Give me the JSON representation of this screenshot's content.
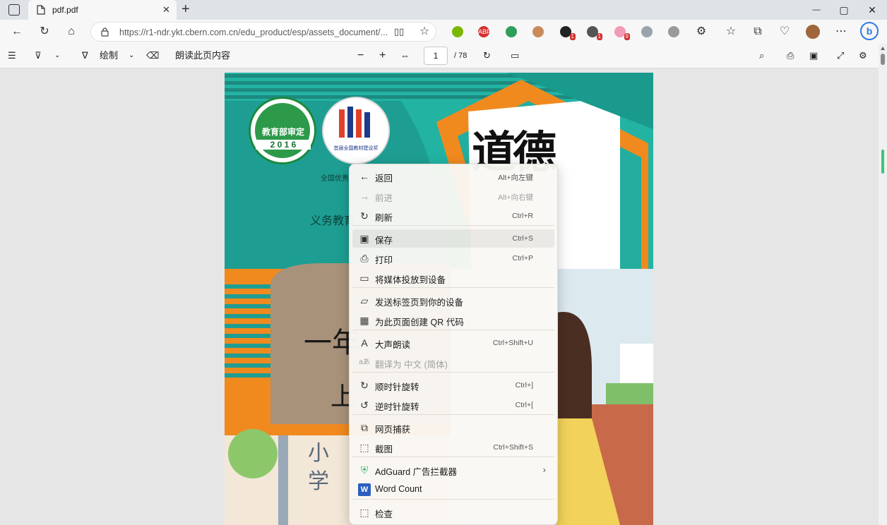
{
  "tab": {
    "title": "pdf.pdf",
    "new_tab": "+"
  },
  "window": {
    "minimize": "—",
    "restore": "▢",
    "close": "✕"
  },
  "address": {
    "url": "https://r1-ndr.ykt.cbern.com.cn/edu_product/esp/assets_document/..."
  },
  "extensions": [
    {
      "name": "extension-green-icon",
      "color": "#7ab800"
    },
    {
      "name": "adblock-icon",
      "color": "#d32f2f",
      "text": "ABP"
    },
    {
      "name": "shield-check-icon",
      "color": "#2e9e5a"
    },
    {
      "name": "face-icon",
      "color": "#c98a5a"
    },
    {
      "name": "ext-black-icon",
      "color": "#222222",
      "badge": "1"
    },
    {
      "name": "ext-chat-icon",
      "color": "#555555",
      "badge": "1"
    },
    {
      "name": "ext-pink-icon",
      "color": "#f29bb5",
      "badge": "9"
    },
    {
      "name": "ext-gray-icon",
      "color": "#9aa3ad"
    },
    {
      "name": "ext-circle-icon",
      "color": "#9a9a9a"
    }
  ],
  "pdf_toolbar": {
    "draw_label": "绘制",
    "read_label": "朗读此页内容",
    "page_current": "1",
    "page_total": "/ 78"
  },
  "cover": {
    "seal_text": "教育部审定",
    "seal_year": "2 0 1 6",
    "award_text": "首届全国教材建设奖",
    "award_caption": "全国优秀",
    "series": "义务教育",
    "title_top": "道德",
    "grade": "一年",
    "volume": "上",
    "bottom_chars": "小学"
  },
  "context_menu": {
    "items": [
      {
        "icon": "back-arrow-icon",
        "glyph": "←",
        "label": "返回",
        "shortcut": "Alt+向左键",
        "disabled": false
      },
      {
        "icon": "forward-arrow-icon",
        "glyph": "→",
        "label": "前进",
        "shortcut": "Alt+向右键",
        "disabled": true
      },
      {
        "icon": "refresh-icon",
        "glyph": "↻",
        "label": "刷新",
        "shortcut": "Ctrl+R",
        "disabled": false
      },
      {
        "icon": "save-icon",
        "glyph": "▣",
        "label": "保存",
        "shortcut": "Ctrl+S",
        "disabled": false
      },
      {
        "icon": "print-icon",
        "glyph": "⎙",
        "label": "打印",
        "shortcut": "Ctrl+P",
        "disabled": false
      },
      {
        "icon": "cast-icon",
        "glyph": "▭",
        "label": "将媒体投放到设备",
        "shortcut": "",
        "disabled": false
      },
      {
        "icon": "send-to-device-icon",
        "glyph": "▱",
        "label": "发送标签页到你的设备",
        "shortcut": "",
        "disabled": false
      },
      {
        "icon": "qr-code-icon",
        "glyph": "▦",
        "label": "为此页面创建 QR 代码",
        "shortcut": "",
        "disabled": false
      },
      {
        "icon": "read-aloud-icon",
        "glyph": "A",
        "label": "大声朗读",
        "shortcut": "Ctrl+Shift+U",
        "disabled": false
      },
      {
        "icon": "translate-icon",
        "glyph": "aあ",
        "label": "翻译为 中文 (简体)",
        "shortcut": "",
        "disabled": true
      },
      {
        "icon": "rotate-clockwise-icon",
        "glyph": "↻",
        "label": "顺时针旋转",
        "shortcut": "Ctrl+]",
        "disabled": false
      },
      {
        "icon": "rotate-counterclockwise-icon",
        "glyph": "↺",
        "label": "逆时针旋转",
        "shortcut": "Ctrl+[",
        "disabled": false
      },
      {
        "icon": "web-capture-icon",
        "glyph": "⧉",
        "label": "网页捕获",
        "shortcut": "",
        "disabled": false
      },
      {
        "icon": "screenshot-icon",
        "glyph": "⬚",
        "label": "截图",
        "shortcut": "Ctrl+Shift+S",
        "disabled": false
      },
      {
        "icon": "adguard-icon",
        "glyph": "⛨",
        "label": "AdGuard 广告拦截器",
        "shortcut": "",
        "disabled": false,
        "submenu": true
      },
      {
        "icon": "word-count-icon",
        "glyph": "W",
        "label": "Word Count",
        "shortcut": "",
        "disabled": false
      },
      {
        "icon": "inspect-icon",
        "glyph": "⬚",
        "label": "检查",
        "shortcut": "",
        "disabled": false
      }
    ]
  }
}
